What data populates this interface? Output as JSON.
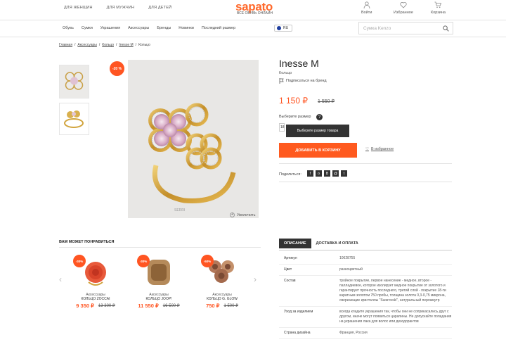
{
  "header": {
    "top_links": [
      "ДЛЯ ЖЕНЩИН",
      "ДЛЯ МУЖЧИН",
      "ДЛЯ ДЕТЕЙ"
    ],
    "logo": "sapato",
    "tagline": "ВСЕ ОБУВЬ ОНЛАЙН",
    "user_links": [
      {
        "label": "Войти",
        "icon": "user-icon"
      },
      {
        "label": "Избранное",
        "icon": "heart-icon"
      },
      {
        "label": "Корзина",
        "icon": "cart-icon"
      }
    ]
  },
  "nav": {
    "items": [
      "Обувь",
      "Сумки",
      "Украшения",
      "Аксессуары",
      "Бренды",
      "Новинки",
      "Последний размер"
    ],
    "lang": "RU",
    "search_placeholder": "Сумка Kenzo"
  },
  "breadcrumb": [
    "Главная",
    "Аксессуары",
    "Кольцо",
    "Inesse M",
    "Кольцо"
  ],
  "product": {
    "discount": "-20 %",
    "zoom_label": "Увеличить",
    "image_caption": "SERRI",
    "title": "Inesse M",
    "subtitle": "Кольцо",
    "follow_brand": "Подписаться на бренд",
    "price": "1 150 ₽",
    "old_price": "1 550 ₽",
    "size_label": "Выберите размер",
    "size_value": "18",
    "help": "?",
    "tooltip": "Выберите размер товара",
    "add_to_cart": "ДОБАВИТЬ В КОРЗИНУ",
    "favorite": "В избранное",
    "share_label": "Поделиться:",
    "social": [
      "f",
      "о",
      "В",
      "@",
      "t"
    ]
  },
  "recommendations": {
    "title": "ВАМ МОЖЕТ ПОНРАВИТЬСЯ",
    "items": [
      {
        "discount": "-30%",
        "category": "Аксессуары",
        "name": "КОЛЬЦО ZOCCAI",
        "price": "9 350 ₽",
        "old_price": "13 300 ₽"
      },
      {
        "discount": "-30%",
        "category": "Аксессуары",
        "name": "КОЛЬЦО JOOP!",
        "price": "11 550 ₽",
        "old_price": "16 500 ₽"
      },
      {
        "discount": "-50%",
        "category": "Аксессуары",
        "name": "КОЛЬЦО G. GLOW",
        "price": "750 ₽",
        "old_price": "1 500 ₽"
      }
    ]
  },
  "details": {
    "tabs": [
      "ОПИСАНИЕ",
      "ДОСТАВКА И ОПЛАТА"
    ],
    "rows": [
      {
        "k": "Артикул",
        "v": "10628755"
      },
      {
        "k": "Цвет",
        "v": "разноцветный"
      },
      {
        "k": "Состав",
        "v": "тройное покрытие, первое нанесение - медное, второе - палладиевое, которое изолирует медное покрытие от золотого и гарантирует прочность последнего, третий слой - покрытие 18-ти каратным золотом 750 пробы, толщина золота 0,3-0,75 микрона, сверкающие кристаллы \"Swarovski\", натуральный перламутр"
      },
      {
        "k": "Уход за изделием",
        "v": "всегда кладите украшения так, чтобы они не соприкасались друг с другом, иначе могут появиться царапины. Не допускайте попадания на украшения лака для волос или дезодорантов"
      },
      {
        "k": "Страна дизайна",
        "v": "Франция, Россия"
      }
    ]
  }
}
